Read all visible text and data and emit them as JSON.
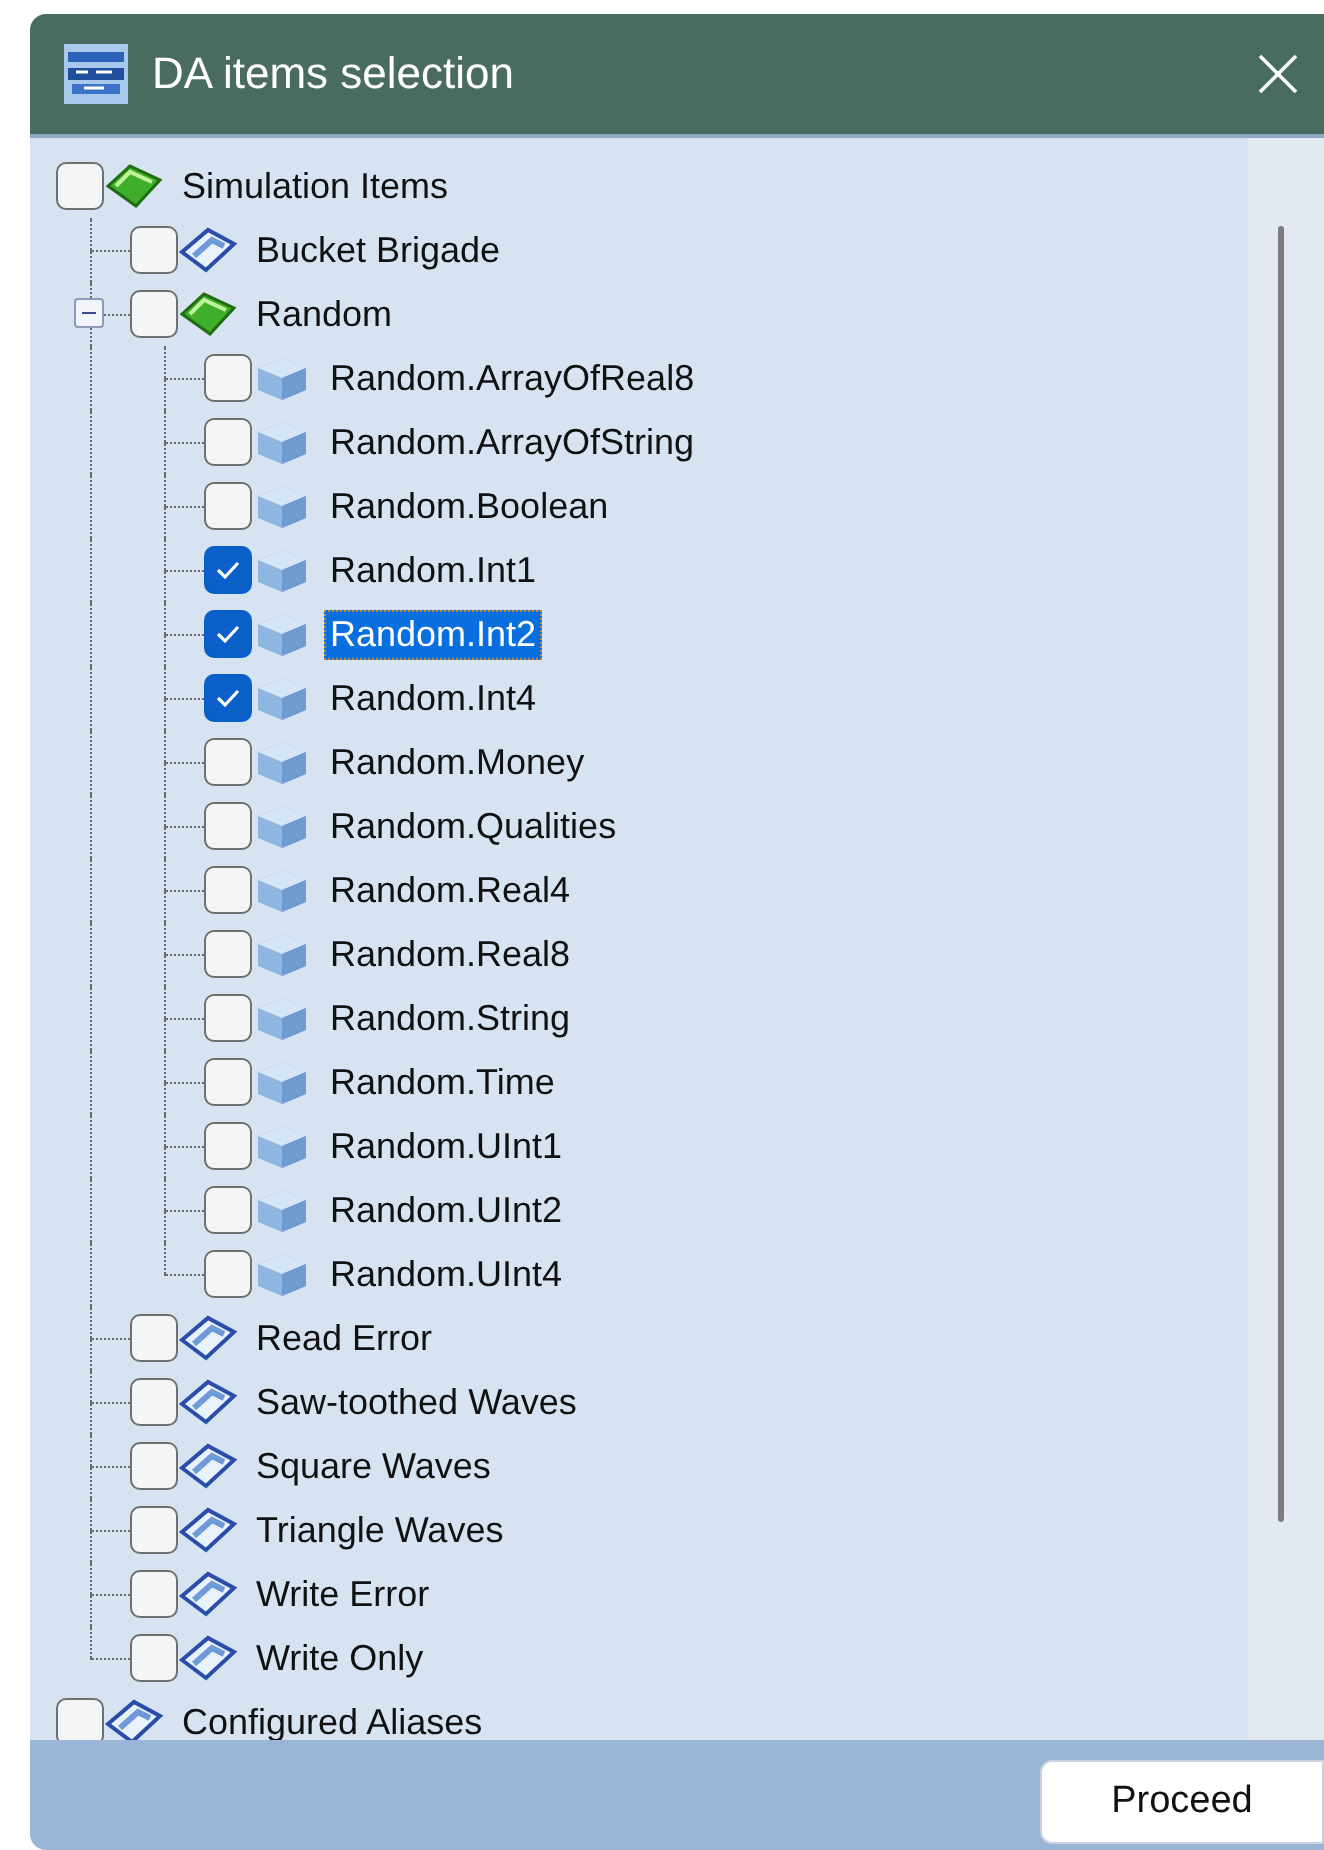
{
  "window": {
    "title": "DA items selection"
  },
  "tree": [
    {
      "label": "Simulation Items",
      "kind": "group",
      "checked": false,
      "selected": false,
      "children": [
        {
          "label": "Bucket Brigade",
          "kind": "tag",
          "checked": false,
          "selected": false
        },
        {
          "label": "Random",
          "kind": "group",
          "checked": false,
          "selected": false,
          "expanded": true,
          "children": [
            {
              "label": "Random.ArrayOfReal8",
              "kind": "item",
              "checked": false,
              "selected": false
            },
            {
              "label": "Random.ArrayOfString",
              "kind": "item",
              "checked": false,
              "selected": false
            },
            {
              "label": "Random.Boolean",
              "kind": "item",
              "checked": false,
              "selected": false
            },
            {
              "label": "Random.Int1",
              "kind": "item",
              "checked": true,
              "selected": false
            },
            {
              "label": "Random.Int2",
              "kind": "item",
              "checked": true,
              "selected": true
            },
            {
              "label": "Random.Int4",
              "kind": "item",
              "checked": true,
              "selected": false
            },
            {
              "label": "Random.Money",
              "kind": "item",
              "checked": false,
              "selected": false
            },
            {
              "label": "Random.Qualities",
              "kind": "item",
              "checked": false,
              "selected": false
            },
            {
              "label": "Random.Real4",
              "kind": "item",
              "checked": false,
              "selected": false
            },
            {
              "label": "Random.Real8",
              "kind": "item",
              "checked": false,
              "selected": false
            },
            {
              "label": "Random.String",
              "kind": "item",
              "checked": false,
              "selected": false
            },
            {
              "label": "Random.Time",
              "kind": "item",
              "checked": false,
              "selected": false
            },
            {
              "label": "Random.UInt1",
              "kind": "item",
              "checked": false,
              "selected": false
            },
            {
              "label": "Random.UInt2",
              "kind": "item",
              "checked": false,
              "selected": false
            },
            {
              "label": "Random.UInt4",
              "kind": "item",
              "checked": false,
              "selected": false
            }
          ]
        },
        {
          "label": "Read Error",
          "kind": "tag",
          "checked": false,
          "selected": false
        },
        {
          "label": "Saw-toothed Waves",
          "kind": "tag",
          "checked": false,
          "selected": false
        },
        {
          "label": "Square Waves",
          "kind": "tag",
          "checked": false,
          "selected": false
        },
        {
          "label": "Triangle Waves",
          "kind": "tag",
          "checked": false,
          "selected": false
        },
        {
          "label": "Write Error",
          "kind": "tag",
          "checked": false,
          "selected": false
        },
        {
          "label": "Write Only",
          "kind": "tag",
          "checked": false,
          "selected": false
        }
      ]
    },
    {
      "label": "Configured Aliases",
      "kind": "tag",
      "checked": false,
      "selected": false
    }
  ],
  "buttons": [
    {
      "label": "Proceed"
    }
  ]
}
